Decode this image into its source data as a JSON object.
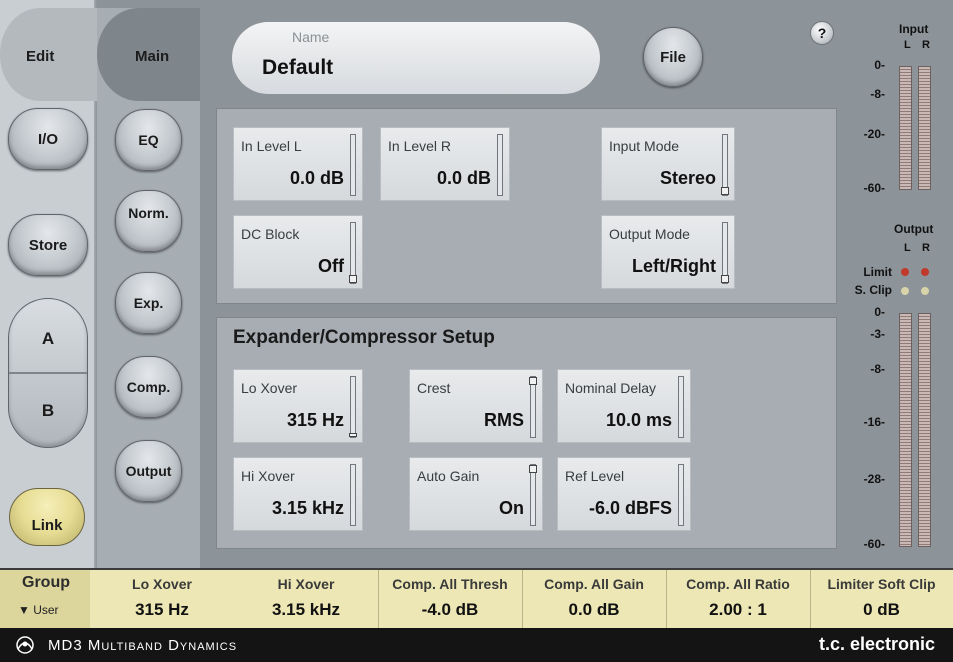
{
  "nav": {
    "edit_tab": "Edit",
    "main_tab": "Main",
    "io_button": "I/O",
    "store_button": "Store",
    "a_button": "A",
    "b_button": "B",
    "link_button": "Link",
    "sub_items": [
      "EQ",
      "Norm.",
      "Exp.",
      "Comp.",
      "Output"
    ]
  },
  "header": {
    "name_label": "Name",
    "name_value": "Default",
    "file_button": "File",
    "help_glyph": "?"
  },
  "io_panel": {
    "in_level_l": {
      "label": "In Level L",
      "value": "0.0 dB"
    },
    "in_level_r": {
      "label": "In Level R",
      "value": "0.0 dB"
    },
    "input_mode": {
      "label": "Input Mode",
      "value": "Stereo"
    },
    "dc_block": {
      "label": "DC Block",
      "value": "Off"
    },
    "output_mode": {
      "label": "Output Mode",
      "value": "Left/Right"
    }
  },
  "setup_panel": {
    "title": "Expander/Compressor Setup",
    "lo_xover": {
      "label": "Lo Xover",
      "value": "315 Hz"
    },
    "hi_xover": {
      "label": "Hi Xover",
      "value": "3.15 kHz"
    },
    "crest": {
      "label": "Crest",
      "value": "RMS"
    },
    "auto_gain": {
      "label": "Auto Gain",
      "value": "On"
    },
    "nominal_delay": {
      "label": "Nominal Delay",
      "value": "10.0 ms"
    },
    "ref_level": {
      "label": "Ref Level",
      "value": "-6.0 dBFS"
    }
  },
  "meters": {
    "input_title": "Input",
    "output_title": "Output",
    "l": "L",
    "r": "R",
    "input_scale": [
      "0-",
      "-8-",
      "-20-",
      "-60-"
    ],
    "output_scale": [
      "0-",
      "-3-",
      "-8-",
      "-16-",
      "-28-",
      "-60-"
    ],
    "limit_label": "Limit",
    "sclip_label": "S. Clip",
    "limit_color": "#c0392b",
    "sclip_color": "#d8d3a8"
  },
  "bottom_bar": {
    "group_label": "Group",
    "group_value": "▼ User",
    "cells": [
      {
        "label": "Lo Xover",
        "value": "315 Hz"
      },
      {
        "label": "Hi Xover",
        "value": "3.15 kHz"
      },
      {
        "label": "Comp. All Thresh",
        "value": "-4.0 dB"
      },
      {
        "label": "Comp. All Gain",
        "value": "0.0 dB"
      },
      {
        "label": "Comp. All Ratio",
        "value": "2.00 : 1"
      },
      {
        "label": "Limiter Soft Clip",
        "value": "0 dB"
      }
    ]
  },
  "footer": {
    "title": "MD3 Multiband Dynamics",
    "brand": "t.c. electronic"
  }
}
